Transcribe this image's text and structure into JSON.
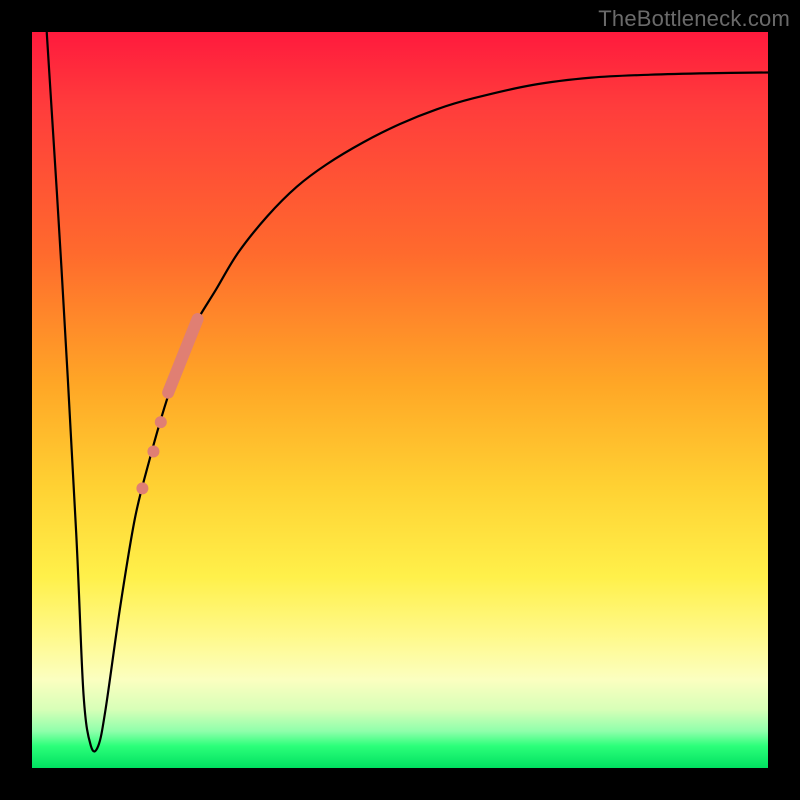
{
  "watermark": "TheBottleneck.com",
  "chart_data": {
    "type": "line",
    "title": "",
    "xlabel": "",
    "ylabel": "",
    "xlim": [
      0,
      100
    ],
    "ylim": [
      0,
      100
    ],
    "grid": false,
    "legend": false,
    "series": [
      {
        "name": "bottleneck-curve",
        "x": [
          2,
          4,
          6,
          7,
          8,
          9,
          10,
          12,
          14,
          16,
          18,
          20,
          22,
          25,
          28,
          32,
          36,
          40,
          45,
          50,
          55,
          60,
          68,
          76,
          84,
          92,
          100
        ],
        "y": [
          100,
          68,
          32,
          10,
          3,
          3,
          8,
          22,
          34,
          42,
          49,
          55,
          60,
          65,
          70,
          75,
          79,
          82,
          85,
          87.5,
          89.5,
          91,
          92.8,
          93.8,
          94.2,
          94.4,
          94.5
        ],
        "color": "#000000",
        "stroke_width": 2
      }
    ],
    "overlays": [
      {
        "name": "highlight-segment",
        "type": "thick-line",
        "color": "#e07f73",
        "width": 12,
        "points": [
          {
            "x": 18.5,
            "y": 51
          },
          {
            "x": 22.5,
            "y": 61
          }
        ]
      },
      {
        "name": "highlight-dots",
        "type": "dots",
        "color": "#e07f73",
        "radius": 6,
        "points": [
          {
            "x": 17.5,
            "y": 47
          },
          {
            "x": 16.5,
            "y": 43
          },
          {
            "x": 15.0,
            "y": 38
          }
        ]
      }
    ],
    "background_gradient": {
      "orientation": "vertical",
      "stops": [
        {
          "value": 100,
          "color": "#ff1a3d"
        },
        {
          "value": 50,
          "color": "#ffd233"
        },
        {
          "value": 10,
          "color": "#fbffc0"
        },
        {
          "value": 0,
          "color": "#00e060"
        }
      ]
    }
  }
}
